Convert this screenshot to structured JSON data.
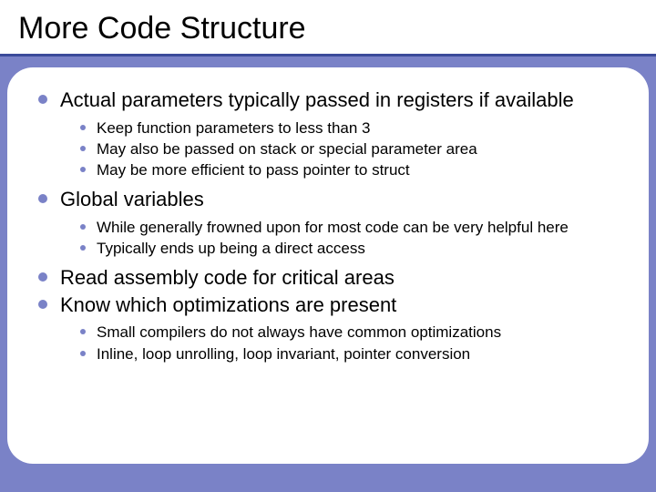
{
  "title": "More Code Structure",
  "bullets": [
    {
      "text": "Actual parameters typically passed in registers if available",
      "sub": [
        "Keep function parameters to less than 3",
        "May also be passed on stack or special parameter area",
        "May be more efficient to pass pointer to struct"
      ]
    },
    {
      "text": "Global variables",
      "sub": [
        "While generally frowned upon for most code can be very helpful here",
        "Typically ends up being a direct access"
      ]
    },
    {
      "text": "Read assembly code for critical areas",
      "sub": []
    },
    {
      "text": "Know which optimizations are present",
      "sub": [
        "Small compilers do not always have common optimizations",
        "Inline, loop unrolling, loop invariant, pointer conversion"
      ]
    }
  ]
}
